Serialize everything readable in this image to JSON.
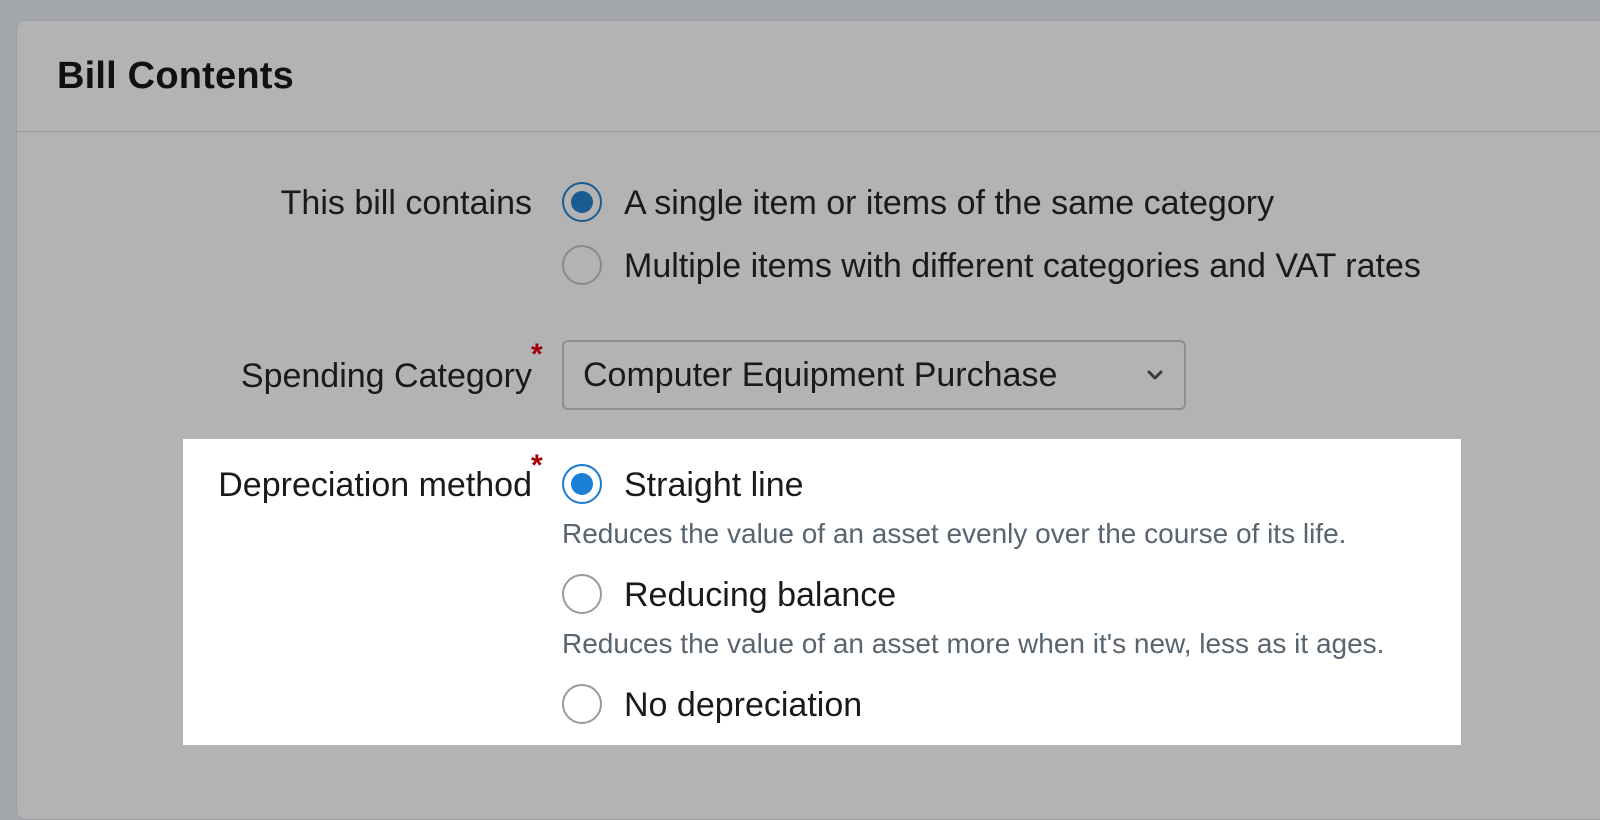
{
  "panel": {
    "title": "Bill Contents"
  },
  "bill_contains": {
    "label": "This bill contains",
    "options": [
      {
        "label": "A single item or items of the same category",
        "selected": true
      },
      {
        "label": "Multiple items with different categories and VAT rates",
        "selected": false
      }
    ]
  },
  "spending_category": {
    "label": "Spending Category",
    "required_marker": "*",
    "value": "Computer Equipment Purchase"
  },
  "depreciation": {
    "label": "Depreciation method",
    "required_marker": "*",
    "options": [
      {
        "label": "Straight line",
        "help": "Reduces the value of an asset evenly over the course of its life.",
        "selected": true
      },
      {
        "label": "Reducing balance",
        "help": "Reduces the value of an asset more when it's new, less as it ages.",
        "selected": false
      },
      {
        "label": "No depreciation",
        "selected": false
      }
    ]
  },
  "colors": {
    "required": "#a0000a",
    "radio_selected_dim": "#1a5c92",
    "radio_selected_active": "#1a80d6",
    "help_text": "#586571"
  },
  "icons": {
    "select_caret": "chevron-down-icon"
  }
}
